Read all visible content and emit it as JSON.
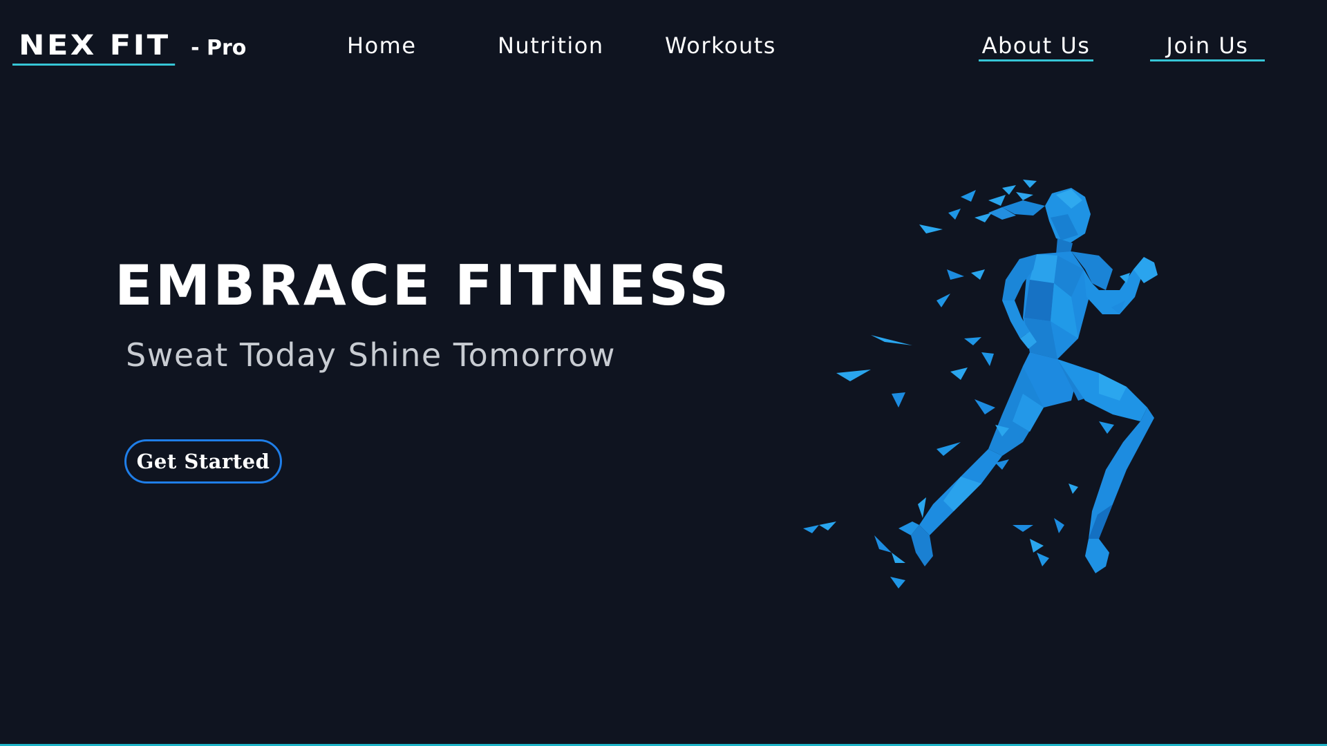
{
  "brand": {
    "logo_main": "NEX FIT",
    "logo_sub": "- Pro"
  },
  "nav": {
    "home": "Home",
    "nutrition": "Nutrition",
    "workouts": "Workouts",
    "about": "About Us",
    "join": "Join Us"
  },
  "hero": {
    "title": "EMBRACE FITNESS",
    "subtitle": "Sweat Today Shine Tomorrow",
    "cta_label": "Get Started",
    "illustration": "low-poly-running-woman"
  },
  "colors": {
    "background": "#0f1420",
    "accent_cyan": "#36c6d6",
    "button_border": "#1f7ee8",
    "figure_blue": "#1c8ee0",
    "subtitle_gray": "#c8ccd2"
  }
}
